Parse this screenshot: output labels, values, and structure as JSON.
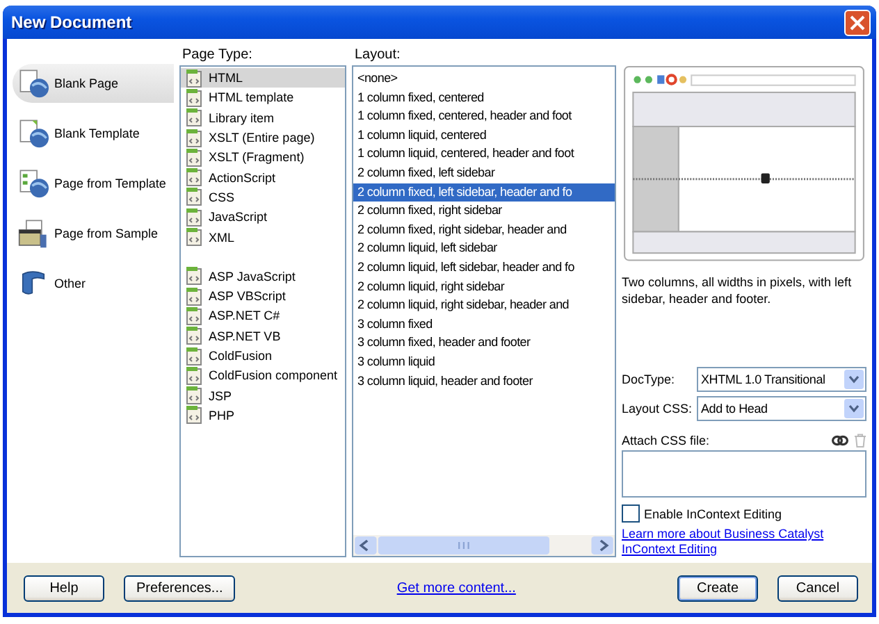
{
  "window": {
    "title": "New Document"
  },
  "categories": [
    {
      "label": "Blank Page",
      "kind": "blank-page",
      "selected": true
    },
    {
      "label": "Blank Template",
      "kind": "blank-template",
      "selected": false
    },
    {
      "label": "Page from Template",
      "kind": "page-template",
      "selected": false
    },
    {
      "label": "Page from Sample",
      "kind": "page-sample",
      "selected": false
    },
    {
      "label": "Other",
      "kind": "other",
      "selected": false
    }
  ],
  "page_type": {
    "label": "Page Type:",
    "groups": [
      [
        {
          "label": "HTML",
          "selected": true
        },
        {
          "label": "HTML template",
          "selected": false
        },
        {
          "label": "Library item",
          "selected": false
        },
        {
          "label": "XSLT (Entire page)",
          "selected": false
        },
        {
          "label": "XSLT (Fragment)",
          "selected": false
        },
        {
          "label": "ActionScript",
          "selected": false
        },
        {
          "label": "CSS",
          "selected": false
        },
        {
          "label": "JavaScript",
          "selected": false
        },
        {
          "label": "XML",
          "selected": false
        }
      ],
      [
        {
          "label": "ASP JavaScript",
          "selected": false
        },
        {
          "label": "ASP VBScript",
          "selected": false
        },
        {
          "label": "ASP.NET C#",
          "selected": false
        },
        {
          "label": "ASP.NET VB",
          "selected": false
        },
        {
          "label": "ColdFusion",
          "selected": false
        },
        {
          "label": "ColdFusion component",
          "selected": false
        },
        {
          "label": "JSP",
          "selected": false
        },
        {
          "label": "PHP",
          "selected": false
        }
      ]
    ]
  },
  "layout": {
    "label": "Layout:",
    "items": [
      {
        "label": "<none>",
        "selected": false
      },
      {
        "label": "1 column fixed, centered",
        "selected": false
      },
      {
        "label": "1 column fixed, centered, header and foot",
        "selected": false
      },
      {
        "label": "1 column liquid, centered",
        "selected": false
      },
      {
        "label": "1 column liquid, centered, header and foot",
        "selected": false
      },
      {
        "label": "2 column fixed, left sidebar",
        "selected": false
      },
      {
        "label": "2 column fixed, left sidebar, header and fo",
        "selected": true
      },
      {
        "label": "2 column fixed, right sidebar",
        "selected": false
      },
      {
        "label": "2 column fixed, right sidebar, header and",
        "selected": false
      },
      {
        "label": "2 column liquid, left sidebar",
        "selected": false
      },
      {
        "label": "2 column liquid, left sidebar, header and fo",
        "selected": false
      },
      {
        "label": "2 column liquid, right sidebar",
        "selected": false
      },
      {
        "label": "2 column liquid, right sidebar, header and",
        "selected": false
      },
      {
        "label": "3 column fixed",
        "selected": false
      },
      {
        "label": "3 column fixed, header and footer",
        "selected": false
      },
      {
        "label": "3 column liquid",
        "selected": false
      },
      {
        "label": "3 column liquid, header and footer",
        "selected": false
      }
    ]
  },
  "preview": {
    "description": "Two columns, all widths in pixels, with left sidebar, header and footer."
  },
  "doctype": {
    "label": "DocType:",
    "value": "XHTML 1.0 Transitional"
  },
  "layout_css": {
    "label": "Layout CSS:",
    "value": "Add to Head"
  },
  "attach_css": {
    "label": "Attach CSS file:",
    "remove_disabled": true
  },
  "incontext": {
    "label": "Enable InContext Editing",
    "checked": false
  },
  "learn_more_link": "Learn more about Business Catalyst InContext Editing",
  "footer": {
    "help": "Help",
    "preferences": "Preferences...",
    "get_more": "Get more content...",
    "create": "Create",
    "cancel": "Cancel"
  }
}
